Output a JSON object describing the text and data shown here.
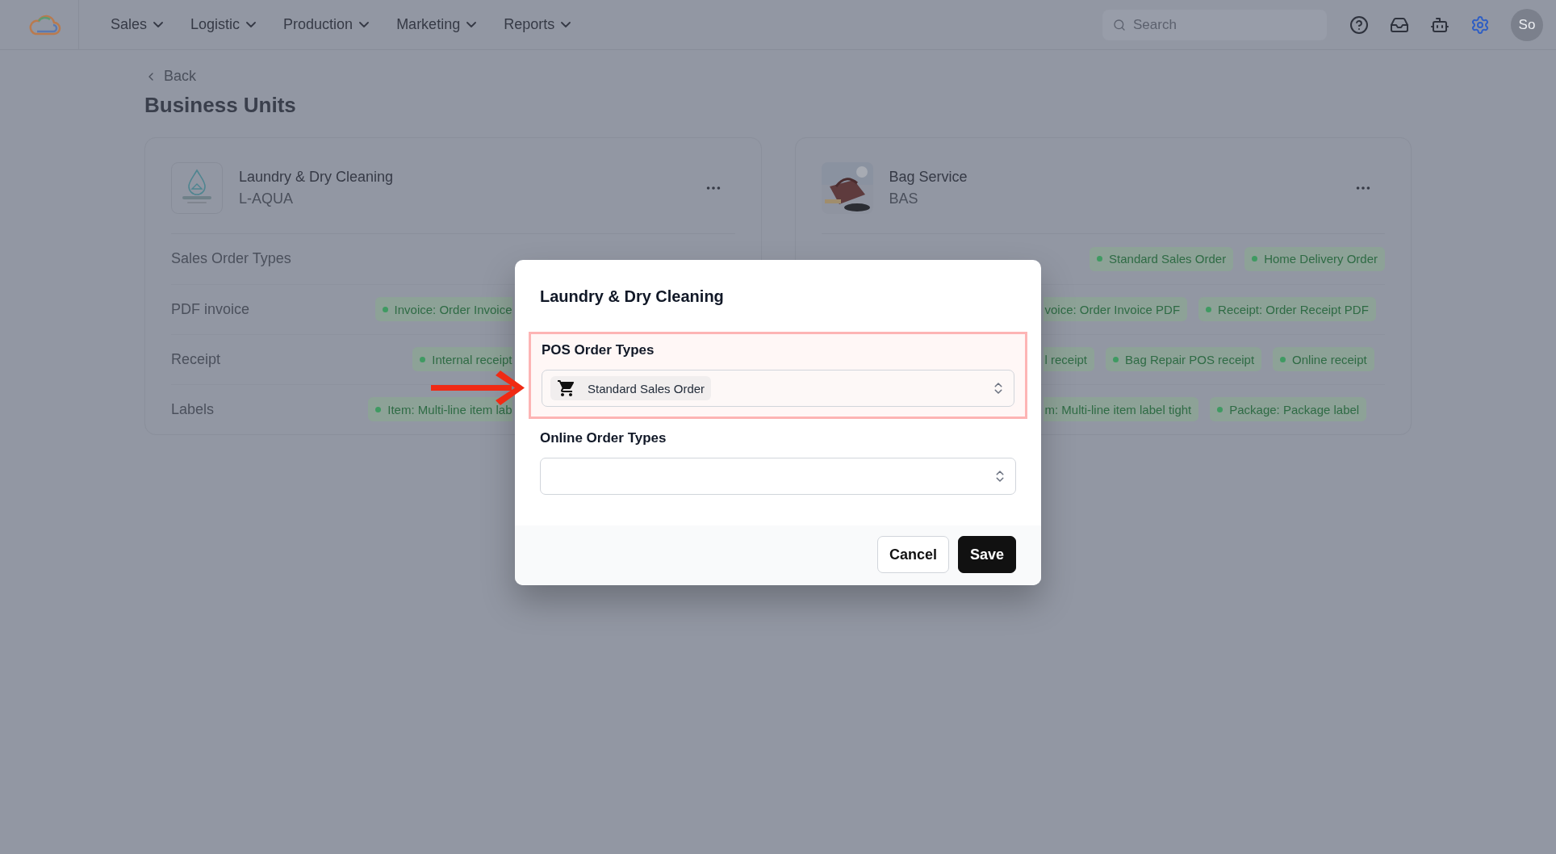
{
  "nav": {
    "items": [
      {
        "label": "Sales"
      },
      {
        "label": "Logistic"
      },
      {
        "label": "Production"
      },
      {
        "label": "Marketing"
      },
      {
        "label": "Reports"
      }
    ],
    "search": {
      "placeholder": "Search"
    },
    "tools": [
      {
        "kind": "help",
        "selected": false
      },
      {
        "kind": "inbox",
        "selected": false
      },
      {
        "kind": "bot",
        "selected": false
      },
      {
        "kind": "settings",
        "selected": true
      }
    ],
    "avatar": "So"
  },
  "back": "Back",
  "title": "Business Units",
  "cards": [
    {
      "name": "Laundry & Dry Cleaning",
      "code": "L-AQUA",
      "rows": [
        {
          "label": "Sales Order Types"
        },
        {
          "label": "PDF invoice",
          "tags": [
            {
              "text": "Invoice: Order Invoice",
              "cut_start": false,
              "cut_end": true
            }
          ]
        },
        {
          "label": "Receipt",
          "tags": [
            {
              "text": "Internal receipt",
              "cut_start": false,
              "cut_end": true
            }
          ]
        },
        {
          "label": "Labels",
          "tags": [
            {
              "text": "Item: Multi-line item lab",
              "cut_start": false,
              "cut_end": true
            }
          ]
        }
      ]
    },
    {
      "name": "Bag Service",
      "code": "BAS",
      "rows": [
        {
          "tags": [
            {
              "text": "Standard Sales Order",
              "cut_start": false,
              "cut_end": false
            },
            {
              "text": "Home Delivery Order",
              "cut_start": false,
              "cut_end": false
            }
          ]
        },
        {
          "tags": [
            {
              "text": "voice: Order Invoice PDF",
              "cut_start": true,
              "cut_end": false
            },
            {
              "text": "Receipt: Order Receipt PDF",
              "cut_start": false,
              "cut_end": false
            }
          ]
        },
        {
          "tags": [
            {
              "text": "l receipt",
              "cut_start": true,
              "cut_end": false
            },
            {
              "text": "Bag Repair POS receipt",
              "cut_start": false,
              "cut_end": false
            },
            {
              "text": "Online receipt",
              "cut_start": false,
              "cut_end": false
            }
          ]
        },
        {
          "tags": [
            {
              "text": "m: Multi-line item label tight",
              "cut_start": true,
              "cut_end": false
            },
            {
              "text": "Package: Package label",
              "cut_start": false,
              "cut_end": false
            }
          ]
        }
      ]
    }
  ],
  "modal": {
    "title": "Laundry & Dry Cleaning",
    "fields": [
      {
        "label": "POS Order Types",
        "highlighted": true,
        "chips": [
          {
            "text": "Standard Sales Order"
          }
        ]
      },
      {
        "label": "Online Order Types",
        "highlighted": false
      }
    ],
    "buttons": [
      {
        "label": "Cancel",
        "kind": "secondary"
      },
      {
        "label": "Save",
        "kind": "primary"
      }
    ]
  }
}
